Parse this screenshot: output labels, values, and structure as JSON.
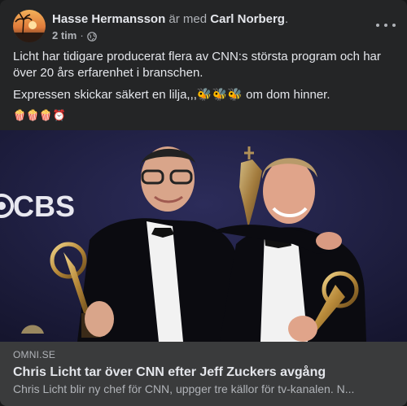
{
  "post": {
    "author": "Hasse Hermansson",
    "with_text": " är med ",
    "tagged": "Carl Norberg",
    "period": ".",
    "time": "2 tim",
    "dot": "·",
    "body_line1": "Licht har tidigare producerat flera av CNN:s största program och har över 20 års erfarenhet i branschen.",
    "body_line2_prefix": "Expressen skickar säkert en lilja,,,",
    "body_line2_emoji": "🐝🐝🐝",
    "body_line2_suffix": " om dom hinner.",
    "emoji_row": "🍿🍿🍿⏰"
  },
  "photo": {
    "backdrop_logo": "CBS"
  },
  "link": {
    "domain": "OMNI.SE",
    "title": "Chris Licht tar över CNN efter Jeff Zuckers avgång",
    "description": "Chris Licht blir ny chef för CNN, uppger tre källor för tv-kanalen. N..."
  },
  "colors": {
    "card": "#242526",
    "link_box": "#3a3b3c",
    "text_primary": "#e4e6eb",
    "text_secondary": "#b0b3b8"
  }
}
